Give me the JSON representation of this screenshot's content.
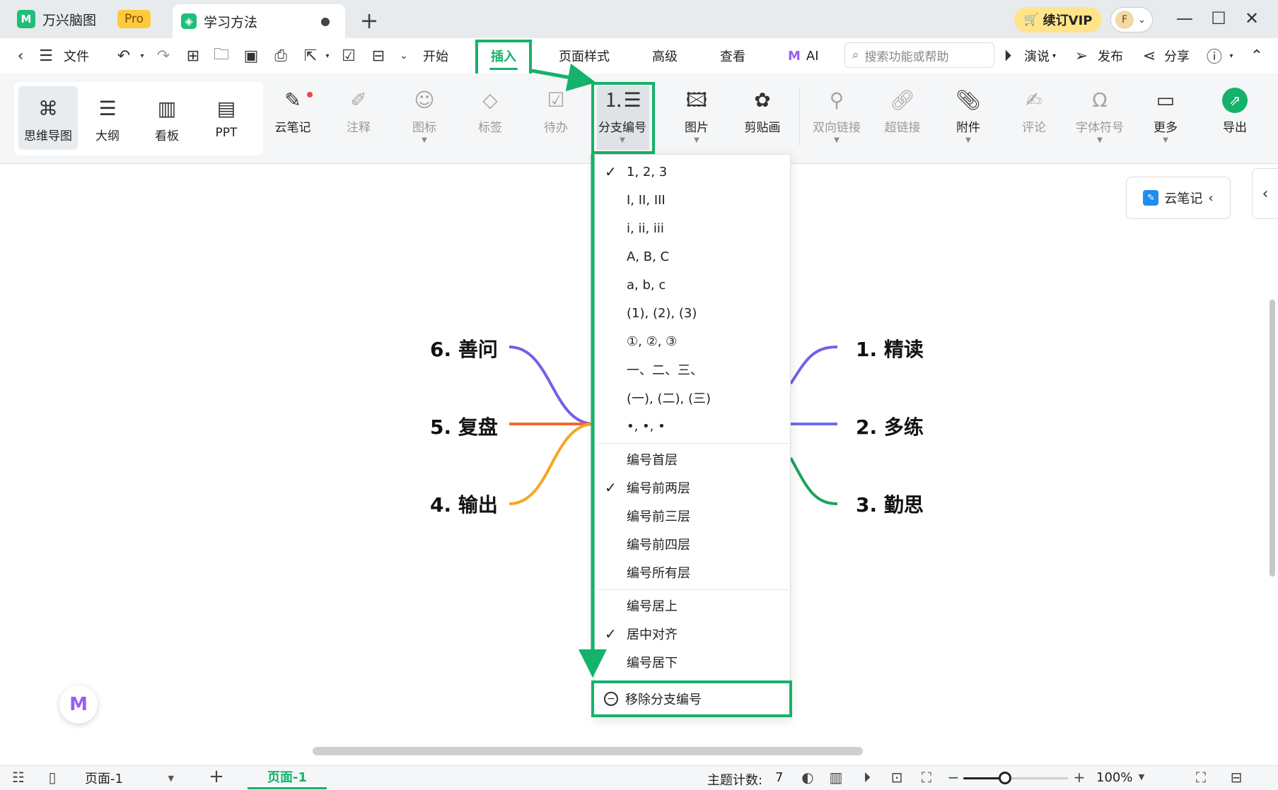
{
  "titlebar": {
    "app_name": "万兴脑图",
    "pro_badge": "Pro",
    "doc_tab": "学习方法",
    "new_tab": "+",
    "vip": "续订VIP",
    "avatar_letter": "F"
  },
  "menubar": {
    "file": "文件",
    "start": "开始",
    "insert": "插入",
    "page_style": "页面样式",
    "advanced": "高级",
    "view": "查看",
    "ai": "AI",
    "search_placeholder": "搜索功能或帮助",
    "present": "演说",
    "publish": "发布",
    "share": "分享"
  },
  "ribbon": {
    "views": [
      "思维导图",
      "大纲",
      "看板",
      "PPT"
    ],
    "cloud_note": "云笔记",
    "annotation": "注释",
    "icon": "图标",
    "tag": "标签",
    "todo": "待办",
    "branch_numbering": "分支编号",
    "image": "图片",
    "clipart": "剪贴画",
    "bidirectional_link": "双向链接",
    "hyperlink": "超链接",
    "attachment": "附件",
    "comment": "评论",
    "font_symbol": "字体符号",
    "more": "更多",
    "export": "导出"
  },
  "canvas": {
    "topics_left": [
      "6. 善问",
      "5. 复盘",
      "4. 输出"
    ],
    "topics_right": [
      "1. 精读",
      "2. 多练",
      "3. 勤思"
    ],
    "cloud_note_panel": "云笔记",
    "branch_colors": {
      "purple": "#7b5ce6",
      "orange_red": "#ef6a2e",
      "orange": "#f5a623",
      "blue_purple": "#6d6cf0",
      "green": "#1aa35a"
    }
  },
  "dropdown": {
    "formats": [
      "1, 2, 3",
      "I, II, III",
      "i, ii, iii",
      "A, B, C",
      "a, b, c",
      "(1), (2), (3)",
      "①, ②, ③",
      "一、二、三、",
      "(一), (二), (三)",
      "•, •, •"
    ],
    "format_selected_index": 0,
    "levels": [
      "编号首层",
      "编号前两层",
      "编号前三层",
      "编号前四层",
      "编号所有层"
    ],
    "level_selected_index": 1,
    "align": [
      "编号居上",
      "居中对齐",
      "编号居下"
    ],
    "align_selected_index": 1,
    "remove": "移除分支编号"
  },
  "statusbar": {
    "page_select": "页面-1",
    "page_tab": "页面-1",
    "topic_count_label": "主题计数:",
    "topic_count": "7",
    "zoom": "100%",
    "zoom_fraction": 0.4
  },
  "accent_color": "#14b26a"
}
